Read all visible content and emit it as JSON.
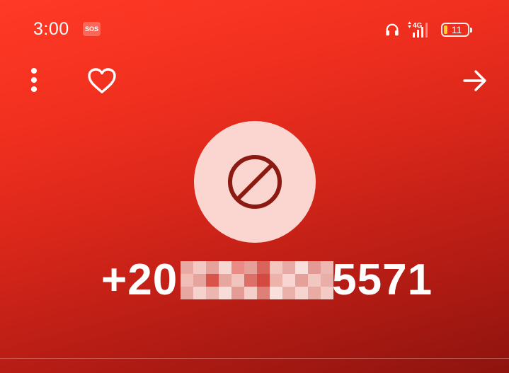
{
  "status_bar": {
    "time": "3:00",
    "sos_label": "SOS",
    "network_label": "4G",
    "battery_level": "11"
  },
  "toolbar": {
    "more_icon": "more-vertical-icon",
    "favorite_icon": "heart-icon",
    "next_icon": "arrow-right-icon"
  },
  "caller": {
    "status_icon": "block-icon",
    "number_prefix": "+20",
    "number_suffix": "5571"
  },
  "colors": {
    "background_top": "#ff3a26",
    "background_bottom": "#8e140e",
    "icon_circle": "#fbd5cf",
    "icon_stroke": "#8a1a12",
    "battery_fill": "#ffd12e"
  }
}
